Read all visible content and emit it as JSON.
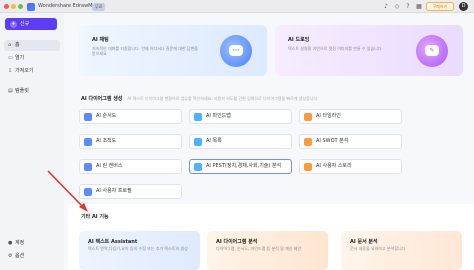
{
  "titlebar": {
    "app_title": "Wondershare EdrawMax",
    "badge": "무료",
    "buy_label": "구매하기",
    "avatar_initial": "D"
  },
  "sidebar": {
    "new_label": "신규",
    "items": [
      {
        "label": "홈",
        "icon": "home-icon"
      },
      {
        "label": "열기",
        "icon": "folder-icon"
      },
      {
        "label": "가져오기",
        "icon": "import-icon"
      },
      {
        "label": "템플릿",
        "icon": "template-icon"
      }
    ],
    "bottom_items": [
      {
        "label": "계정",
        "icon": "account-icon"
      },
      {
        "label": "옵션",
        "icon": "options-icon"
      }
    ]
  },
  "hero": {
    "chat_title": "AI 채팅",
    "chat_desc": "지속적인 대화를 지원합니다. 언제 어디서나 질문에 대한 답변을 받으세요",
    "draw_title": "AI 드로잉",
    "draw_desc": "텍스트 설명을 기반으로 멋진 이미지를 만들 수 있습니다."
  },
  "diagram_section": {
    "title": "AI 다이어그램 생성",
    "desc": "AI 텍스트 다이어그램 변환으로 업무를 혁신하세요. 사용자 의도를 간편 입력으로 다이어그램을 빠르게 생성합니다"
  },
  "templates": [
    {
      "label": "AI 순서도",
      "color": "#5b8cff"
    },
    {
      "label": "AI 마인드맵",
      "color": "#4bb3ff"
    },
    {
      "label": "AI 타임라인",
      "color": "#ff9a3d"
    },
    {
      "label": "AI 조직도",
      "color": "#5b8cff"
    },
    {
      "label": "AI 목록",
      "color": "#4bb3ff"
    },
    {
      "label": "AI SWOT 분석",
      "color": "#ff9a3d"
    },
    {
      "label": "AI 린 캔버스",
      "color": "#5b8cff"
    },
    {
      "label": "AI PEST(정치,경제,사회,기술) 분석",
      "color": "#4bb3ff"
    },
    {
      "label": "AI 사용자 스토리",
      "color": "#ff9a3d"
    },
    {
      "label": "AI 사용자 프로필",
      "color": "#5b8cff"
    }
  ],
  "other": {
    "title": "기타 AI 기능",
    "tools": [
      {
        "title": "AI 텍스트 Assistant",
        "desc": "텍스트 번역,다듬기,요약 등의 수정 또는 추가 텍스트의 생성"
      },
      {
        "title": "AI 다이어그램 분석",
        "desc": "다이어그램, 순서도, 마인드맵 등 분석 및 개선 제안"
      },
      {
        "title": "AI 문서 분석",
        "desc": "문서 내용을 요약하고 분석합니다"
      }
    ]
  },
  "colors": {
    "accent": "#5c3cf5",
    "arrow": "#e0332b"
  }
}
